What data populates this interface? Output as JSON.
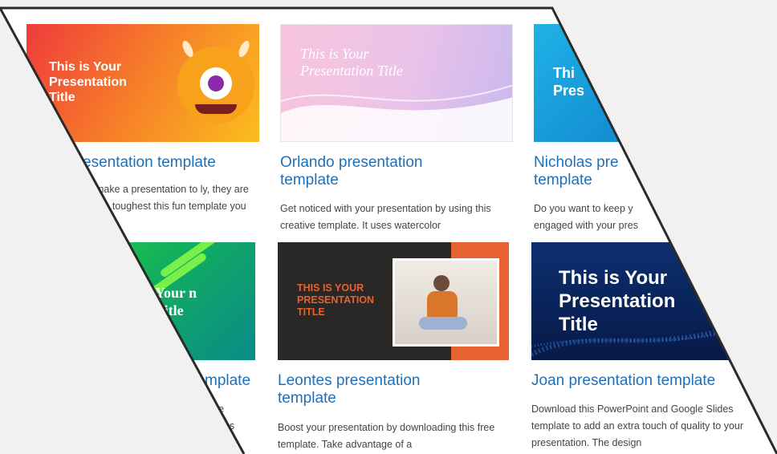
{
  "templates": [
    {
      "title": "esentation template",
      "description": "make a presentation to ly, they are the toughest this fun template you will",
      "thumb_title": "This is Your Presentation Title",
      "colors": {
        "from": "#ef3d3d",
        "to": "#fbbc1d"
      }
    },
    {
      "title": "Orlando presentation template",
      "description": "Get noticed with your presentation by using this creative template. It uses watercolor",
      "thumb_title": "This is Your Presentation Title",
      "colors": {
        "from": "#f7c6de",
        "to": "#c8b8f0"
      }
    },
    {
      "title": "Nicholas pre template",
      "description": "Do you want to keep y engaged with your pres",
      "thumb_title": "Thi Pres",
      "colors": {
        "from": "#1fb3e6",
        "to": "#0a6fc2"
      }
    },
    {
      "title": "mplate",
      "description": "ee apes",
      "thumb_title": "Your n Title",
      "colors": {
        "from": "#18c23a",
        "to": "#0a8a8a"
      }
    },
    {
      "title": "Leontes presentation template",
      "description": "Boost your presentation by downloading this free template. Take advantage of a",
      "thumb_title": "THIS IS YOUR PRESENTATION TITLE",
      "colors": {
        "from": "#2a2727",
        "to": "#e6622e"
      }
    },
    {
      "title": "Joan presentation template",
      "description": "Download this PowerPoint and Google Slides template to add an extra touch of quality to your presentation. The design",
      "thumb_title": "This is Your Presentation Title",
      "colors": {
        "from": "#0b2c6b",
        "to": "#0a1a45"
      }
    }
  ]
}
